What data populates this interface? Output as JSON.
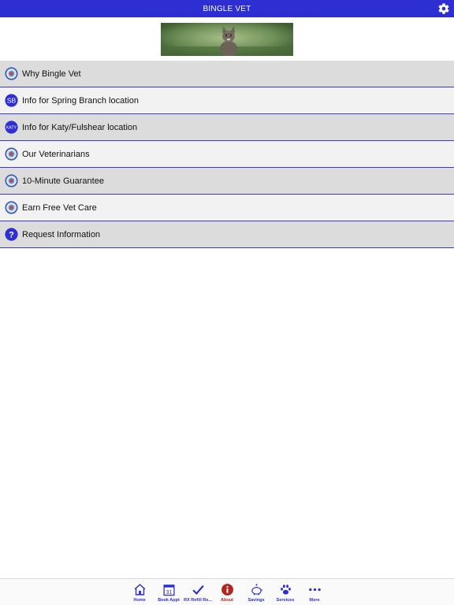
{
  "header": {
    "title": "BINGLE VET",
    "settings_icon": "gear-icon"
  },
  "banner": {
    "alt": "cat-photo"
  },
  "menu": {
    "items": [
      {
        "label": "Why Bingle Vet",
        "icon": "logo-icon"
      },
      {
        "label": "Info for Spring Branch location",
        "icon": "sb-badge-icon",
        "badge": "SB"
      },
      {
        "label": "Info for Katy/Fulshear location",
        "icon": "katy-badge-icon",
        "badge": "KATY"
      },
      {
        "label": "Our Veterinarians",
        "icon": "logo-icon"
      },
      {
        "label": "10-Minute Guarantee",
        "icon": "logo-icon"
      },
      {
        "label": "Earn Free Vet Care",
        "icon": "logo-icon"
      },
      {
        "label": "Request Information",
        "icon": "question-icon"
      }
    ]
  },
  "tabbar": {
    "tabs": [
      {
        "label": "Home",
        "icon": "home-icon"
      },
      {
        "label": "Book Appt",
        "icon": "calendar-icon",
        "day": "31"
      },
      {
        "label": "RX Refill Re...",
        "icon": "checkmark-icon"
      },
      {
        "label": "About",
        "icon": "info-icon",
        "active": true
      },
      {
        "label": "Savings",
        "icon": "piggy-bank-icon"
      },
      {
        "label": "Services",
        "icon": "paw-icon"
      },
      {
        "label": "More",
        "icon": "more-dots-icon"
      }
    ]
  },
  "colors": {
    "primary": "#2d2fd3",
    "active": "#b3261e",
    "row_odd": "#dcdcdc",
    "row_even": "#f2f2f2"
  }
}
